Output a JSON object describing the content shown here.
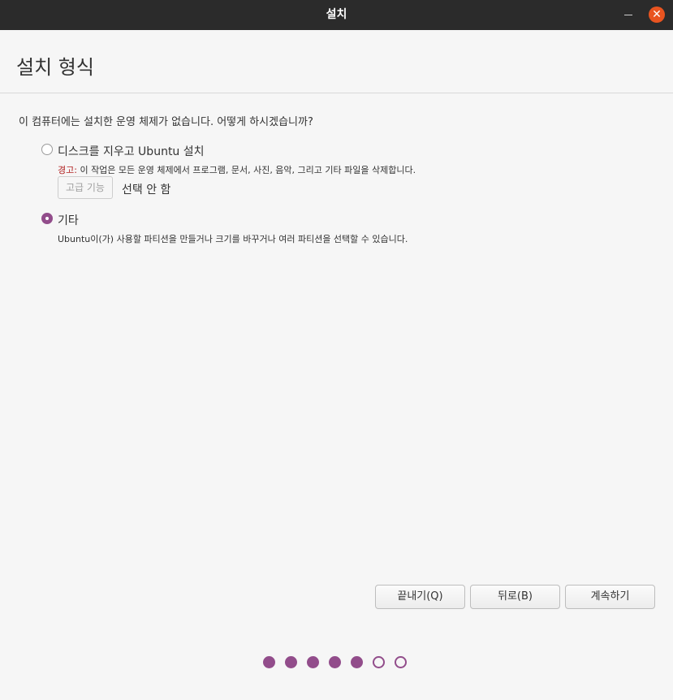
{
  "window": {
    "title": "설치",
    "minimize_icon": "minimize-icon",
    "close_icon": "close-icon",
    "close_glyph": "✕"
  },
  "page": {
    "title": "설치 형식"
  },
  "question": "이 컴퓨터에는 설치한 운영 체제가 없습니다. 어떻게 하시겠습니까?",
  "options": [
    {
      "label": "디스크를 지우고 Ubuntu 설치",
      "selected": false,
      "warning_prefix": "경고:",
      "description": " 이 작업은 모든 운영 체제에서 프로그램, 문서, 사진, 음악, 그리고 기타 파일을 삭제합니다.",
      "advanced_button": "고급 기능",
      "advanced_status": "선택 안 함"
    },
    {
      "label": "기타",
      "selected": true,
      "description": "Ubuntu이(가) 사용할 파티션을 만들거나 크기를 바꾸거나 여러 파티션을 선택할 수 있습니다."
    }
  ],
  "buttons": {
    "quit": "끝내기(Q)",
    "back": "뒤로(B)",
    "continue": "계속하기"
  },
  "progress": {
    "total": 7,
    "completed": 5
  },
  "colors": {
    "accent": "#924d8b",
    "close": "#e95420",
    "titlebar": "#2b2b2b",
    "warning": "#b01e1e"
  }
}
